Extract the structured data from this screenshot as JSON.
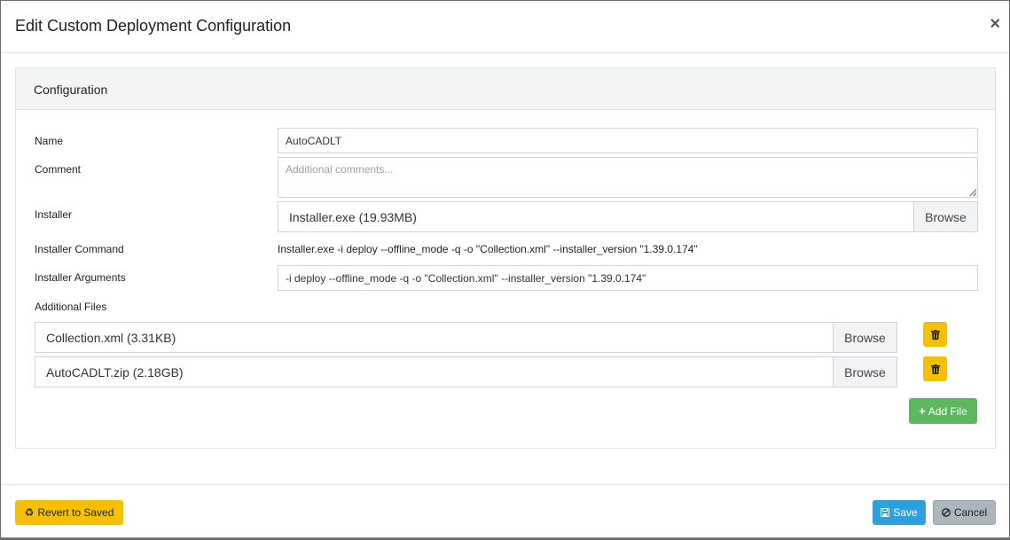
{
  "modal": {
    "title": "Edit Custom Deployment Configuration",
    "close_glyph": "×"
  },
  "card": {
    "header": "Configuration"
  },
  "form": {
    "name_label": "Name",
    "name_value": "AutoCADLT",
    "comment_label": "Comment",
    "comment_placeholder": "Additional comments...",
    "installer_label": "Installer",
    "installer_file": "Installer.exe (19.93MB)",
    "installer_browse": "Browse",
    "installer_command_label": "Installer Command",
    "installer_command_value": "Installer.exe -i deploy --offline_mode -q -o \"Collection.xml\" --installer_version \"1.39.0.174\"",
    "installer_arguments_label": "Installer Arguments",
    "installer_arguments_value": "-i deploy --offline_mode -q -o \"Collection.xml\" --installer_version \"1.39.0.174\"",
    "additional_files_label": "Additional Files",
    "files": [
      {
        "name": "Collection.xml (3.31KB)",
        "browse": "Browse"
      },
      {
        "name": "AutoCADLT.zip (2.18GB)",
        "browse": "Browse"
      }
    ],
    "add_file_label": "Add File",
    "add_file_icon": "plus-icon"
  },
  "footer": {
    "revert_label": "Revert to Saved",
    "revert_icon": "recycle-icon",
    "save_label": "Save",
    "save_icon": "floppy-icon",
    "cancel_label": "Cancel",
    "cancel_icon": "ban-icon"
  },
  "colors": {
    "warning": "#f5c000",
    "success": "#5cb85c",
    "primary": "#2ea0dc",
    "secondary": "#adb5bd"
  }
}
